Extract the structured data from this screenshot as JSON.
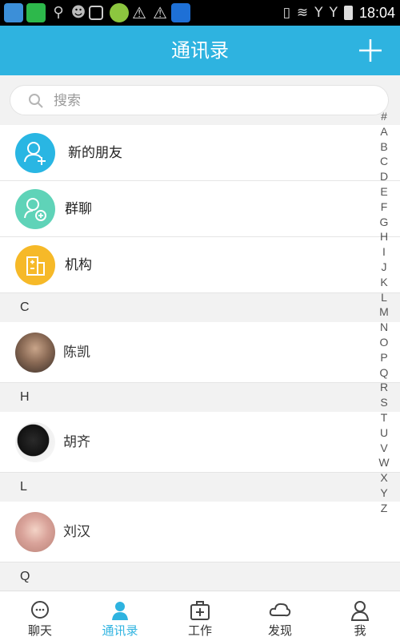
{
  "status_bar": {
    "time": "18:04",
    "battery": ""
  },
  "header": {
    "title": "通讯录"
  },
  "search": {
    "placeholder": "搜索"
  },
  "menu": [
    {
      "label": "新的朋友",
      "icon": "new-friend-icon",
      "color": "#29b6e3"
    },
    {
      "label": "群聊",
      "icon": "group-chat-icon",
      "color": "#5fd3b8"
    },
    {
      "label": "机构",
      "icon": "organization-icon",
      "color": "#f6b928"
    }
  ],
  "sections": [
    {
      "letter": "C",
      "contact": "陈凯"
    },
    {
      "letter": "H",
      "contact": "胡齐"
    },
    {
      "letter": "L",
      "contact": "刘汉"
    },
    {
      "letter": "Q"
    }
  ],
  "alphabet": [
    "#",
    "A",
    "B",
    "C",
    "D",
    "E",
    "F",
    "G",
    "H",
    "I",
    "J",
    "K",
    "L",
    "M",
    "N",
    "O",
    "P",
    "Q",
    "R",
    "S",
    "T",
    "U",
    "V",
    "W",
    "X",
    "Y",
    "Z"
  ],
  "tabs": [
    {
      "label": "聊天",
      "icon": "chat-icon"
    },
    {
      "label": "通讯录",
      "icon": "contacts-icon",
      "active": true
    },
    {
      "label": "工作",
      "icon": "work-icon"
    },
    {
      "label": "发现",
      "icon": "discover-icon"
    },
    {
      "label": "我",
      "icon": "me-icon"
    }
  ],
  "colors": {
    "accent": "#2eb3e0",
    "status_bar": "#000000",
    "section_bg": "#f2f2f2"
  }
}
